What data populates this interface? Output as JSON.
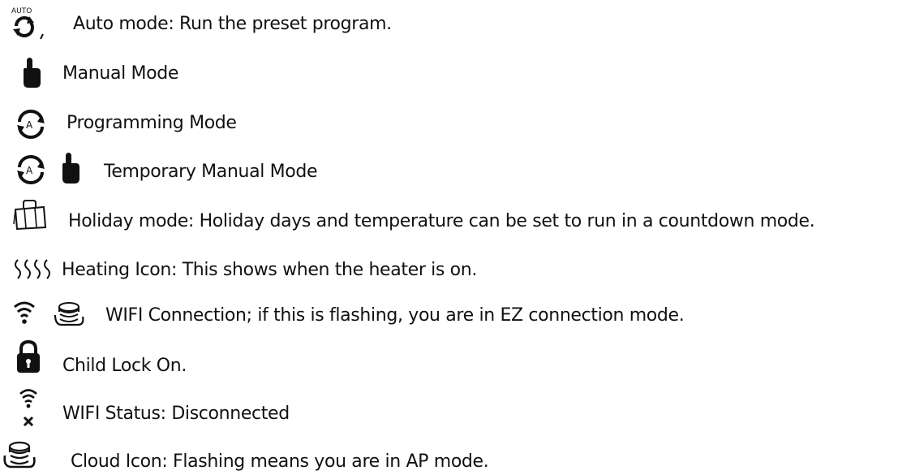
{
  "legend": {
    "items": [
      {
        "icon": "auto-mode-icon",
        "icon_text": "AUTO",
        "text": "Auto mode: Run the preset program."
      },
      {
        "icon": "hand-icon",
        "text": "Manual Mode"
      },
      {
        "icon": "programming-mode-icon",
        "icon_text": "A",
        "text": "Programming Mode"
      },
      {
        "icon": "temporary-manual-icon",
        "icon_text": "A",
        "text": "Temporary Manual Mode"
      },
      {
        "icon": "suitcase-icon",
        "text": "Holiday mode: Holiday days and temperature can be set to run in a countdown mode."
      },
      {
        "icon": "heating-icon",
        "text": "Heating Icon: This shows when the heater is on."
      },
      {
        "icon": "wifi-cloud-icon",
        "text": "WIFI Connection; if this is flashing, you are in EZ connection mode."
      },
      {
        "icon": "lock-icon",
        "text": "Child Lock On."
      },
      {
        "icon": "wifi-disconnected-icon",
        "text": "WIFI Status: Disconnected"
      },
      {
        "icon": "cloud-icon",
        "text": "Cloud Icon: Flashing means you are in AP mode."
      }
    ]
  }
}
